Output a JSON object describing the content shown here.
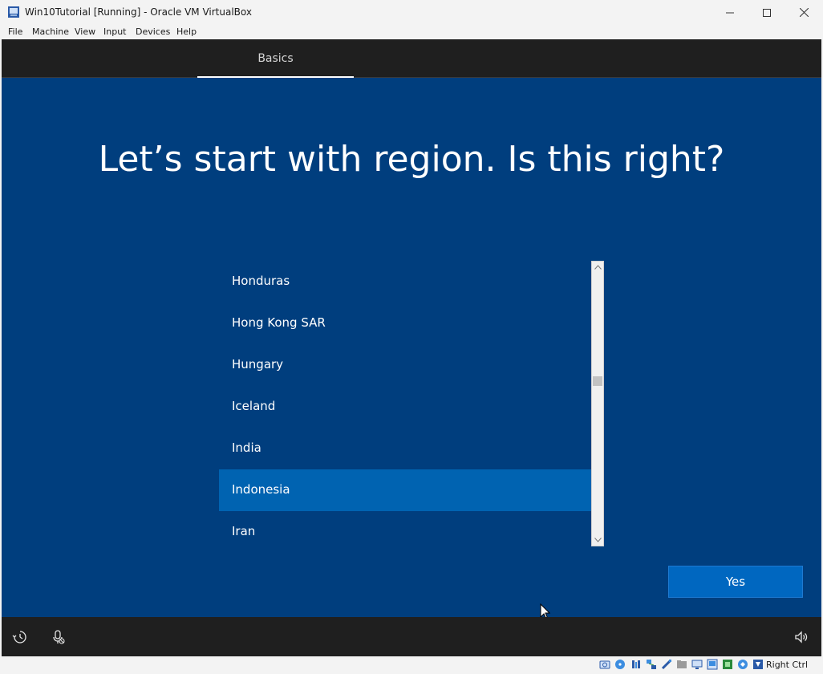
{
  "window": {
    "title": "Win10Tutorial [Running] - Oracle VM VirtualBox"
  },
  "menu": {
    "items": [
      "File",
      "Machine",
      "View",
      "Input",
      "Devices",
      "Help"
    ]
  },
  "oobe": {
    "tab_label": "Basics",
    "heading": "Let’s start with region. Is this right?",
    "regions": [
      {
        "label": "Honduras",
        "selected": false
      },
      {
        "label": "Hong Kong SAR",
        "selected": false
      },
      {
        "label": "Hungary",
        "selected": false
      },
      {
        "label": "Iceland",
        "selected": false
      },
      {
        "label": "India",
        "selected": false
      },
      {
        "label": "Indonesia",
        "selected": true
      },
      {
        "label": "Iran",
        "selected": false
      }
    ],
    "yes_label": "Yes",
    "colors": {
      "background": "#003e7e",
      "selected": "#0063b1",
      "button": "#0067c0"
    }
  },
  "statusbar": {
    "host_key": "Right Ctrl",
    "icons": [
      "hard-disk-icon",
      "optical-drive-icon",
      "audio-icon",
      "network-icon",
      "usb-icon",
      "shared-folders-icon",
      "display-icon",
      "recording-icon",
      "vt-x-icon",
      "cpu-activity-icon",
      "mouse-integration-icon"
    ]
  }
}
